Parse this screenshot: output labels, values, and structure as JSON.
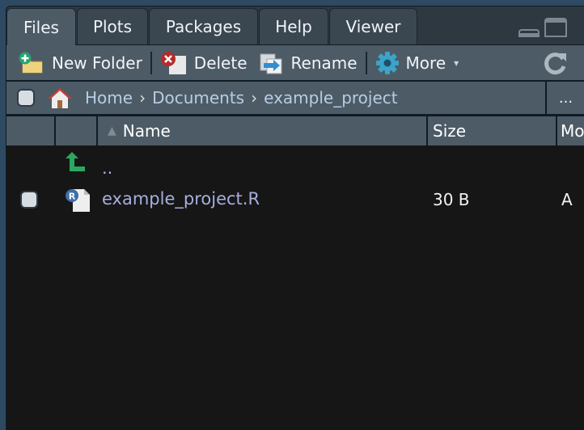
{
  "tabs": [
    {
      "label": "Files",
      "active": true
    },
    {
      "label": "Plots",
      "active": false
    },
    {
      "label": "Packages",
      "active": false
    },
    {
      "label": "Help",
      "active": false
    },
    {
      "label": "Viewer",
      "active": false
    }
  ],
  "window_controls": {
    "minimize_icon": "minimize-pane-icon",
    "maximize_icon": "maximize-pane-icon"
  },
  "toolbar": {
    "new_folder": {
      "label": "New Folder",
      "icon": "new-folder-icon"
    },
    "delete": {
      "label": "Delete",
      "icon": "delete-icon"
    },
    "rename": {
      "label": "Rename",
      "icon": "rename-icon"
    },
    "more": {
      "label": "More",
      "icon": "gear-icon",
      "dropdown": "▾"
    },
    "refresh": {
      "icon": "refresh-icon"
    }
  },
  "breadcrumb": {
    "items": [
      "Home",
      "Documents",
      "example_project"
    ],
    "separator": "›",
    "more_label": "..."
  },
  "columns": {
    "name": "Name",
    "size": "Size",
    "modified": "Mo",
    "sort_indicator": "▲"
  },
  "rows": [
    {
      "type": "parent",
      "name": "..",
      "icon": "up-arrow-icon"
    },
    {
      "type": "file",
      "name": "example_project.R",
      "size": "30 B",
      "modified": "A",
      "icon": "r-file-icon",
      "checked": false
    }
  ],
  "colors": {
    "accent_link": "#a8aedd",
    "breadcrumb": "#b7cde4",
    "panel_bg": "#4d5b66",
    "content_bg": "#161616"
  }
}
